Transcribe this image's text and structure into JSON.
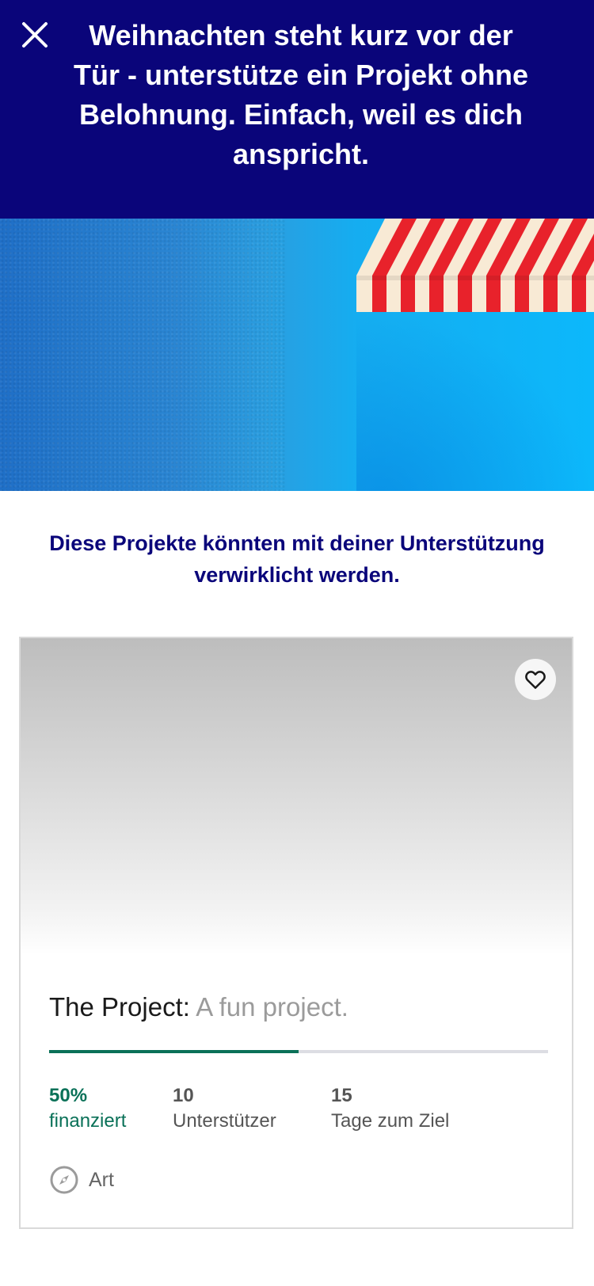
{
  "header": {
    "title": "Weihnachten steht kurz vor der Tür - unterstütze ein Projekt ohne Belohnung. Einfach, weil es dich anspricht.",
    "close_icon": "close-icon",
    "background_color": "#0a057a"
  },
  "hero": {
    "image_description_icon": "awning-illustration",
    "colors": [
      "#1f6fc7",
      "#0cb8fb",
      "#e8222b",
      "#f8ead5"
    ]
  },
  "intro": {
    "text": "Diese Projekte könnten mit deiner Unterstützung verwirklicht werden."
  },
  "project_card": {
    "name": "The Project:",
    "blurb": "A fun project.",
    "favorite_icon": "heart-outline-icon",
    "progress_fraction": 0.5,
    "stats": {
      "funded_value": "50%",
      "funded_label": "finanziert",
      "backers_value": "10",
      "backers_label": "Unterstützer",
      "days_value": "15",
      "days_label": "Tage zum Ziel"
    },
    "category": {
      "icon": "compass-icon",
      "label": "Art"
    },
    "accent_color": "#0a7158"
  }
}
